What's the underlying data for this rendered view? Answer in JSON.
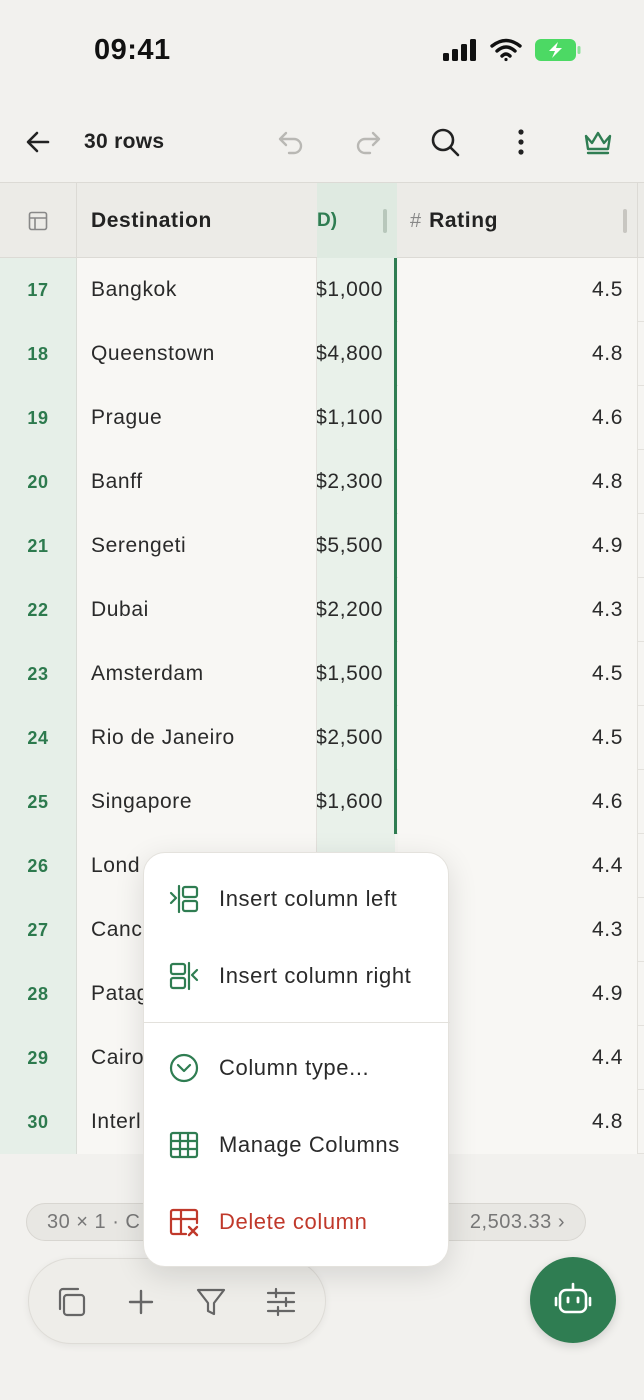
{
  "status": {
    "time": "09:41"
  },
  "toolbar": {
    "rows_label": "30 rows"
  },
  "columns": {
    "destination": "Destination",
    "price_fragment": "D)",
    "rating": "Rating",
    "rating_type_symbol": "#"
  },
  "rows": [
    {
      "num": "17",
      "dest": "Bangkok",
      "price": "$1,000",
      "rating": "4.5"
    },
    {
      "num": "18",
      "dest": "Queenstown",
      "price": "$4,800",
      "rating": "4.8"
    },
    {
      "num": "19",
      "dest": "Prague",
      "price": "$1,100",
      "rating": "4.6"
    },
    {
      "num": "20",
      "dest": "Banff",
      "price": "$2,300",
      "rating": "4.8"
    },
    {
      "num": "21",
      "dest": "Serengeti",
      "price": "$5,500",
      "rating": "4.9"
    },
    {
      "num": "22",
      "dest": "Dubai",
      "price": "$2,200",
      "rating": "4.3"
    },
    {
      "num": "23",
      "dest": "Amsterdam",
      "price": "$1,500",
      "rating": "4.5"
    },
    {
      "num": "24",
      "dest": "Rio de Janeiro",
      "price": "$2,500",
      "rating": "4.5"
    },
    {
      "num": "25",
      "dest": "Singapore",
      "price": "$1,600",
      "rating": "4.6"
    },
    {
      "num": "26",
      "dest": "Lond",
      "price": "",
      "rating": "4.4"
    },
    {
      "num": "27",
      "dest": "Canc",
      "price": "",
      "rating": "4.3"
    },
    {
      "num": "28",
      "dest": "Patag",
      "price": "",
      "rating": "4.9"
    },
    {
      "num": "29",
      "dest": "Cairo",
      "price": "",
      "rating": "4.4"
    },
    {
      "num": "30",
      "dest": "Interl",
      "price": "",
      "rating": "4.8"
    }
  ],
  "summary": {
    "left": "30 × 1 · C",
    "right": "2,503.33 ›"
  },
  "context_menu": {
    "insert_left": "Insert column left",
    "insert_right": "Insert column right",
    "column_type": "Column type...",
    "manage_columns": "Manage Columns",
    "delete_column": "Delete column"
  },
  "colors": {
    "accent": "#2f7d52",
    "danger": "#c0392b",
    "row_num_bg": "#e6efe8"
  }
}
